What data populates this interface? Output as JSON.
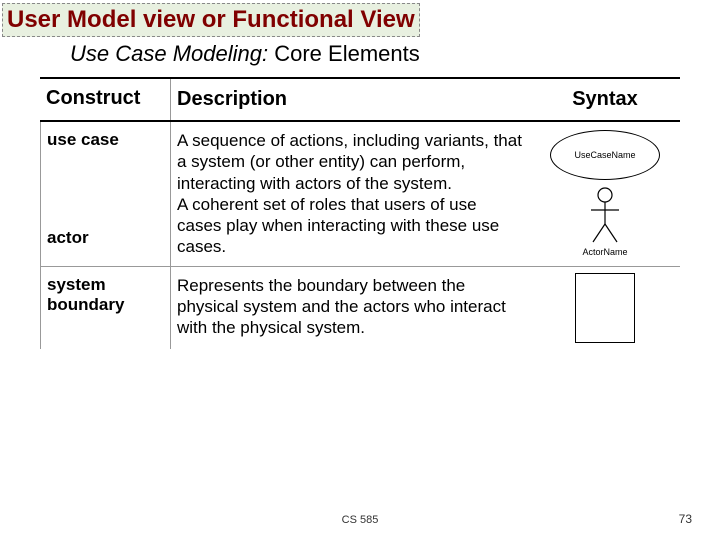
{
  "title": "User Model view or Functional View",
  "subtitle_italic": "Use Case Modeling:",
  "subtitle_rest": " Core Elements",
  "headers": {
    "c1": "Construct",
    "c2": "Description",
    "c3": "Syntax"
  },
  "rows": [
    {
      "construct1": "use case",
      "construct2": "actor",
      "description": "A sequence of actions, including variants, that a system (or other entity) can perform, interacting with actors of the system.\nA coherent set of roles that users of use cases play when interacting with these use cases.",
      "usecase_label": "UseCaseName",
      "actor_label": "ActorName"
    },
    {
      "construct": "system boundary",
      "description": "Represents the boundary between the physical system and the actors who interact with the physical system."
    }
  ],
  "footer": {
    "course": "CS 585",
    "page": "73"
  }
}
